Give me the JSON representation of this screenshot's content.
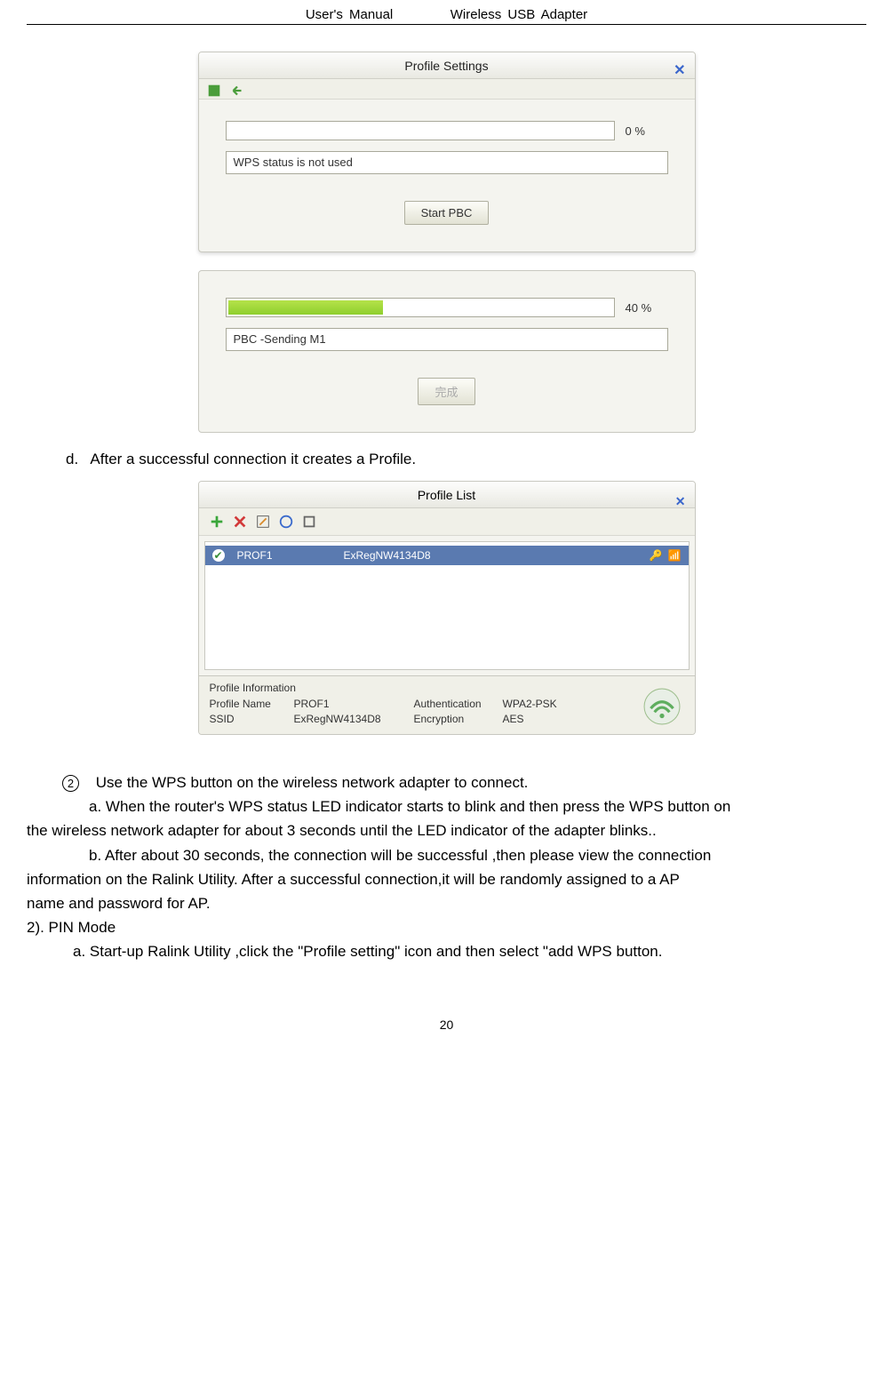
{
  "header": {
    "left": "User's Manual",
    "right": "Wireless USB Adapter"
  },
  "dialog1": {
    "title": "Profile Settings",
    "percent": "0 %",
    "status": "WPS status is not used",
    "button": "Start PBC"
  },
  "dialog2": {
    "percent": "40 %",
    "fill_percent": 40,
    "status": "PBC -Sending M1",
    "button": "完成"
  },
  "para_d": {
    "prefix": "d.",
    "text": "After a successful connection it creates a ",
    "bold": "Profile",
    "suffix": "."
  },
  "profile_list": {
    "title": "Profile List",
    "row": {
      "name": "PROF1",
      "ssid": "ExRegNW4134D8"
    },
    "info": {
      "legend": "Profile Information",
      "labels": {
        "profile_name": "Profile Name",
        "ssid": "SSID",
        "auth": "Authentication",
        "enc": "Encryption"
      },
      "values": {
        "profile_name": "PROF1",
        "ssid": "ExRegNW4134D8",
        "auth": "WPA2-PSK",
        "enc": "AES"
      }
    }
  },
  "section2": {
    "step2_intro": "Use the WPS button on the wireless network adapter to connect.",
    "a_line1": "a.    When the router's WPS status LED indicator starts to blink and then press the WPS button on",
    "a_line2": "the wireless network adapter for about 3 seconds until the LED indicator of the adapter blinks..",
    "b_line1": "b.    After about 30 seconds, the connection will be successful ,then please view the connection",
    "b_line2": "information on the Ralink Utility. After a successful connection,it will be randomly assigned to a   AP",
    "b_line3": "name and password for AP.",
    "pin_heading": "2). PIN Mode",
    "pin_a": "a.    Start-up Ralink Utility ,click the \"Profile setting\" icon and then select \"add WPS button."
  },
  "page_number": "20"
}
